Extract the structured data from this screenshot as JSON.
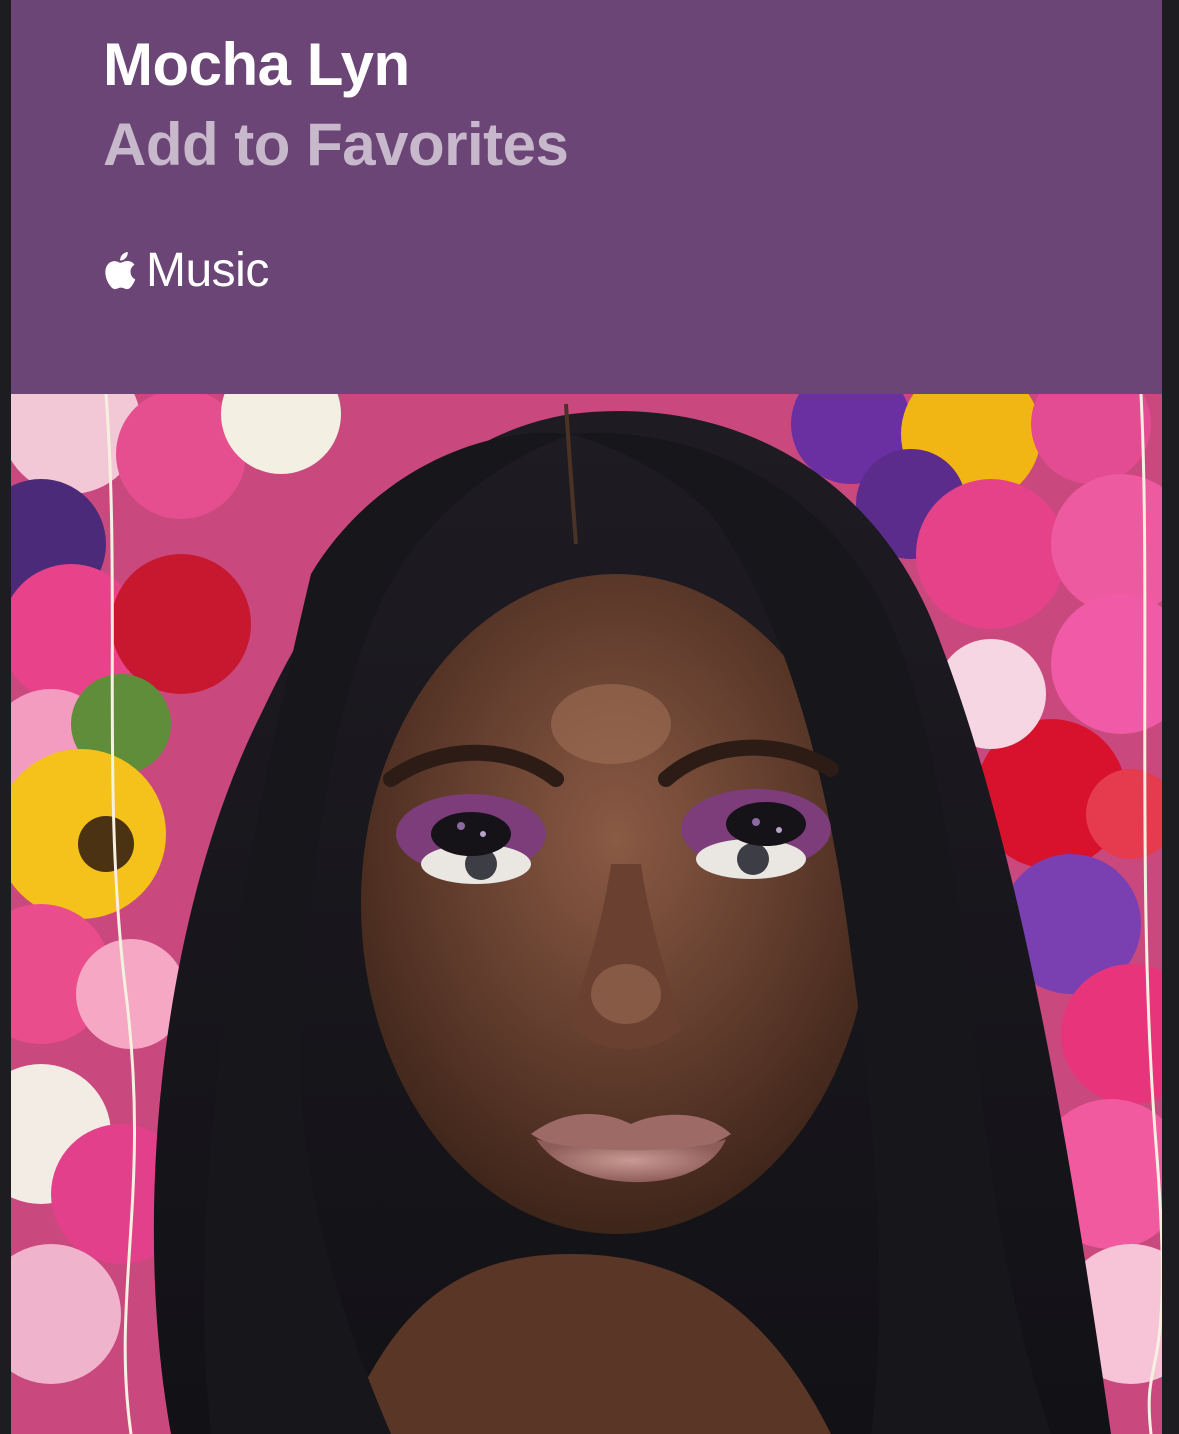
{
  "card": {
    "artist_name": "Mocha Lyn",
    "action_label": "Add to Favorites",
    "brand_text": "Music",
    "brand_icon": "apple-logo-icon"
  },
  "colors": {
    "header_background": "#6c4577",
    "artist_name_color": "#ffffff",
    "action_color": "#c8b8cc",
    "page_background": "#1d1c20"
  },
  "photo": {
    "subject": "artist-portrait"
  }
}
